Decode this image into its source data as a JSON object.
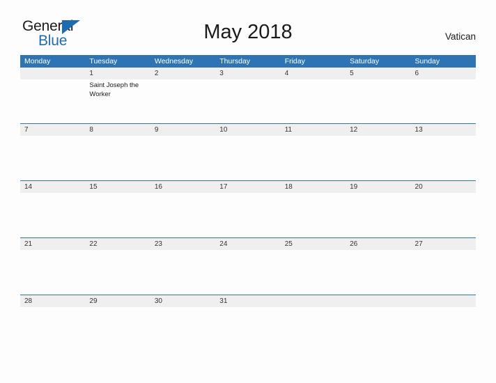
{
  "brand": {
    "name_part1": "General",
    "name_part2": "Blue",
    "triangle_icon": "triangle-icon",
    "colors": {
      "black": "#1a1a1a",
      "blue": "#1f6bb0"
    }
  },
  "header": {
    "title": "May 2018",
    "region": "Vatican"
  },
  "calendar": {
    "accent_color": "#2e74b5",
    "date_band_color": "#efefef",
    "weekdays": [
      "Monday",
      "Tuesday",
      "Wednesday",
      "Thursday",
      "Friday",
      "Saturday",
      "Sunday"
    ],
    "weeks": [
      {
        "top_rule": false,
        "days": [
          {
            "date": "",
            "events": []
          },
          {
            "date": "1",
            "events": [
              "Saint Joseph the Worker"
            ]
          },
          {
            "date": "2",
            "events": []
          },
          {
            "date": "3",
            "events": []
          },
          {
            "date": "4",
            "events": []
          },
          {
            "date": "5",
            "events": []
          },
          {
            "date": "6",
            "events": []
          }
        ]
      },
      {
        "top_rule": true,
        "days": [
          {
            "date": "7",
            "events": []
          },
          {
            "date": "8",
            "events": []
          },
          {
            "date": "9",
            "events": []
          },
          {
            "date": "10",
            "events": []
          },
          {
            "date": "11",
            "events": []
          },
          {
            "date": "12",
            "events": []
          },
          {
            "date": "13",
            "events": []
          }
        ]
      },
      {
        "top_rule": true,
        "days": [
          {
            "date": "14",
            "events": []
          },
          {
            "date": "15",
            "events": []
          },
          {
            "date": "16",
            "events": []
          },
          {
            "date": "17",
            "events": []
          },
          {
            "date": "18",
            "events": []
          },
          {
            "date": "19",
            "events": []
          },
          {
            "date": "20",
            "events": []
          }
        ]
      },
      {
        "top_rule": true,
        "days": [
          {
            "date": "21",
            "events": []
          },
          {
            "date": "22",
            "events": []
          },
          {
            "date": "23",
            "events": []
          },
          {
            "date": "24",
            "events": []
          },
          {
            "date": "25",
            "events": []
          },
          {
            "date": "26",
            "events": []
          },
          {
            "date": "27",
            "events": []
          }
        ]
      },
      {
        "top_rule": true,
        "days": [
          {
            "date": "28",
            "events": []
          },
          {
            "date": "29",
            "events": []
          },
          {
            "date": "30",
            "events": []
          },
          {
            "date": "31",
            "events": []
          },
          {
            "date": "",
            "events": []
          },
          {
            "date": "",
            "events": []
          },
          {
            "date": "",
            "events": []
          }
        ]
      }
    ]
  }
}
